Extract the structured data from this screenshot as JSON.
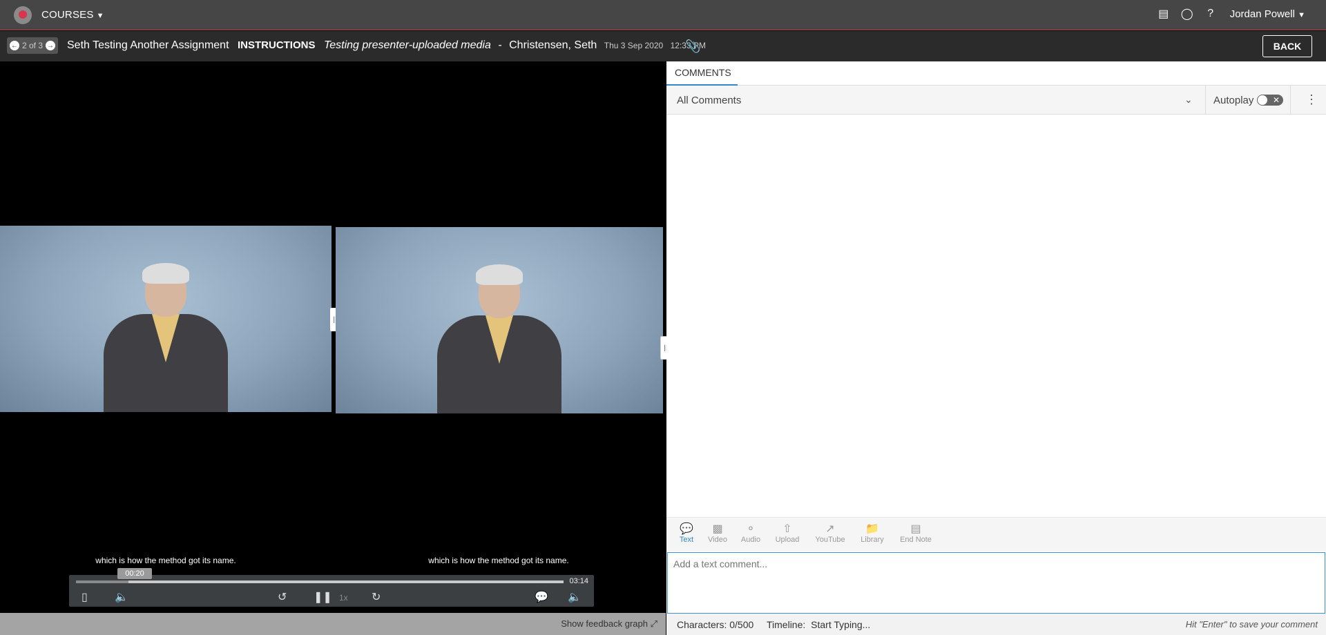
{
  "topbar": {
    "courses_label": "COURSES",
    "user_name": "Jordan Powell",
    "icons": [
      "library-icon",
      "lightbulb-icon",
      "help-icon"
    ]
  },
  "subbar": {
    "pager_text": "2 of 3",
    "assignment_title": "Seth Testing Another Assignment",
    "instructions_label": "INSTRUCTIONS",
    "media_title": "Testing presenter-uploaded media",
    "separator": "-",
    "presenter_name": "Christensen, Seth",
    "date": "Thu 3 Sep 2020",
    "time": "12:33 PM",
    "back_label": "BACK"
  },
  "player": {
    "caption_left": "which is how the method got its name.",
    "caption_right": "which is how the method got its name.",
    "current_time": "00:20",
    "duration": "03:14",
    "progress": 0.107,
    "speed": "1x",
    "show_feedback_graph": "Show feedback graph"
  },
  "comments": {
    "tab_label": "COMMENTS",
    "filter_label": "All Comments",
    "autoplay_label": "Autoplay",
    "tools": [
      {
        "label": "Text",
        "icon": "speech-bubble-icon",
        "active": true
      },
      {
        "label": "Video",
        "icon": "video-camera-icon",
        "active": false
      },
      {
        "label": "Audio",
        "icon": "microphone-icon",
        "active": false
      },
      {
        "label": "Upload",
        "icon": "upload-arrow-icon",
        "active": false
      },
      {
        "label": "YouTube",
        "icon": "external-link-icon",
        "active": false
      },
      {
        "label": "Library",
        "icon": "folder-icon",
        "active": false
      },
      {
        "label": "End Note",
        "icon": "note-icon",
        "active": false
      }
    ],
    "placeholder": "Add a text comment...",
    "characters": "Characters: 0/500",
    "timeline_label": "Timeline:",
    "timeline_value": "Start Typing...",
    "hint": "Hit \"Enter\" to save your comment"
  }
}
